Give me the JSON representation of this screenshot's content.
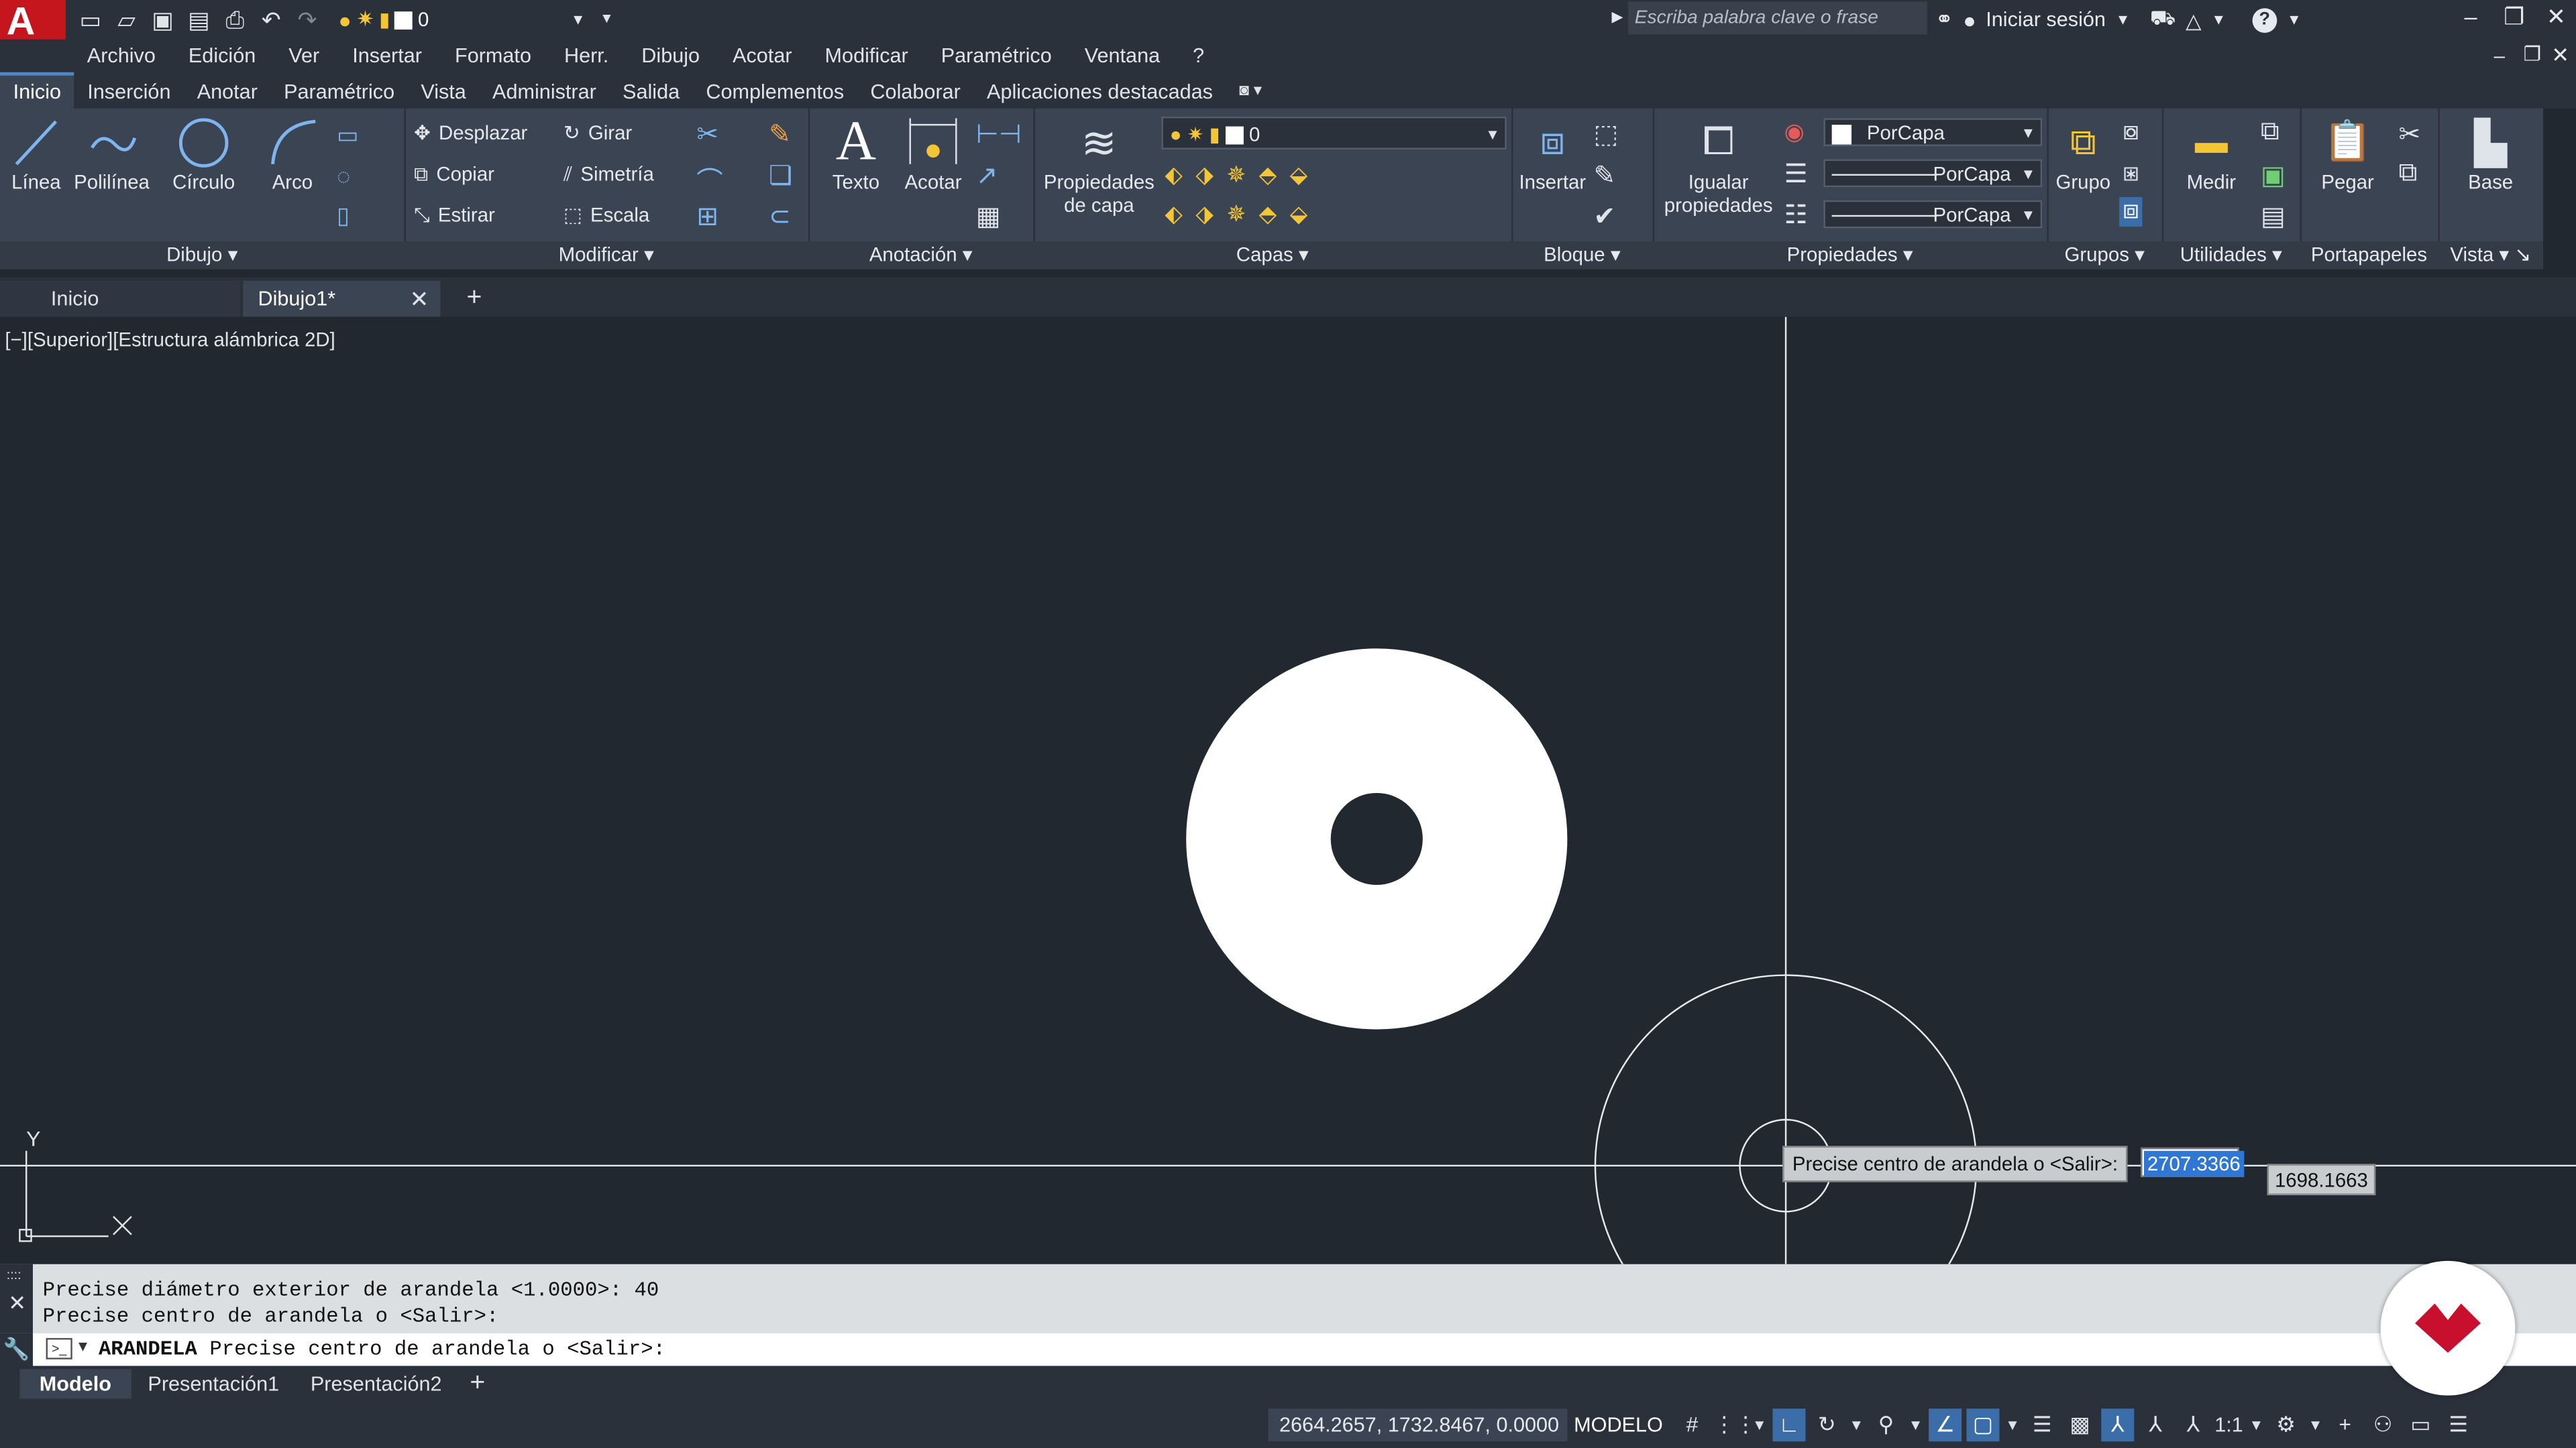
{
  "app": {
    "logo_letter": "A",
    "layer_value": "0",
    "search_placeholder": "Escriba palabra clave o frase",
    "signin_label": "Iniciar sesión",
    "help_label": "?"
  },
  "menu": [
    "Archivo",
    "Edición",
    "Ver",
    "Insertar",
    "Formato",
    "Herr.",
    "Dibujo",
    "Acotar",
    "Modificar",
    "Paramétrico",
    "Ventana",
    "?"
  ],
  "ribbon_tabs": [
    "Inicio",
    "Inserción",
    "Anotar",
    "Paramétrico",
    "Vista",
    "Administrar",
    "Salida",
    "Complementos",
    "Colaborar",
    "Aplicaciones destacadas"
  ],
  "ribbon": {
    "dibujo": {
      "title": "Dibujo",
      "linea": "Línea",
      "polilinea": "Polilínea",
      "circulo": "Círculo",
      "arco": "Arco"
    },
    "modificar": {
      "title": "Modificar",
      "desplazar": "Desplazar",
      "girar": "Girar",
      "copiar": "Copiar",
      "simetria": "Simetría",
      "estirar": "Estirar",
      "escala": "Escala"
    },
    "anotacion": {
      "title": "Anotación",
      "texto": "Texto",
      "acotar": "Acotar"
    },
    "capas": {
      "title": "Capas",
      "prop_line1": "Propiedades",
      "prop_line2": "de capa",
      "layer_value": "0"
    },
    "bloque": {
      "title": "Bloque",
      "insertar": "Insertar"
    },
    "propiedades": {
      "title": "Propiedades",
      "igualar_line1": "Igualar",
      "igualar_line2": "propiedades",
      "color": "PorCapa",
      "linetype": "PorCapa",
      "lineweight": "PorCapa"
    },
    "grupos": {
      "title": "Grupos",
      "grupo": "Grupo"
    },
    "utilidades": {
      "title": "Utilidades",
      "medir": "Medir"
    },
    "portapapeles": {
      "title": "Portapapeles",
      "pegar": "Pegar"
    },
    "vista": {
      "title": "Vista",
      "base": "Base"
    }
  },
  "doc_tabs": {
    "inicio": "Inicio",
    "dibujo": "Dibujo1*"
  },
  "viewport_label": "[−][Superior][Estructura alámbrica 2D]",
  "tooltip": {
    "prompt": "Precise centro de arandela o <Salir>:",
    "x_value": "2707.3366",
    "y_value": "1698.1663"
  },
  "ucs": {
    "y": "Y"
  },
  "command": {
    "history": [
      "Precise diámetro exterior de arandela <1.0000>: 40",
      "Precise centro de arandela o <Salir>:"
    ],
    "current_cmd": "ARANDELA",
    "current_prompt": "Precise centro de arandela o <Salir>:"
  },
  "layout_tabs": [
    "Modelo",
    "Presentación1",
    "Presentación2"
  ],
  "status": {
    "coords": "2664.2657, 1732.8467, 0.0000",
    "model": "MODELO",
    "scale": "1:1"
  },
  "colors": {
    "canvas": "#212830",
    "ribbon": "#3b4452",
    "accent": "#2f77d2",
    "logo": "#c4161c",
    "brand": "#c8102e"
  }
}
